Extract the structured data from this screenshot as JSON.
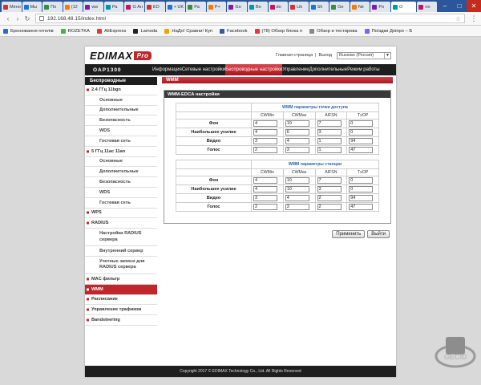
{
  "browser": {
    "tabs": [
      "Мено",
      "Мы",
      "По",
      "(12",
      "ww",
      "Ра",
      "G Ан",
      "ED",
      "+ UK",
      "Ра",
      "Р+",
      "Go",
      "Во",
      "do",
      "Lik",
      "Sh",
      "Ge",
      "Ne",
      "Po",
      "O",
      "no"
    ],
    "active_tab_index": 19,
    "url": "192.168.48.15/index.html",
    "bookmarks": [
      {
        "label": "Бронювання готелів",
        "color": "#2a6bd1"
      },
      {
        "label": "ROZETKA",
        "color": "#4caf50"
      },
      {
        "label": "AliExpress",
        "color": "#e53935"
      },
      {
        "label": "Lamoda",
        "color": "#222222"
      },
      {
        "label": "НаДо! Сравни! Куп",
        "color": "#f4a300"
      },
      {
        "label": "Facebook",
        "color": "#3b5998"
      },
      {
        "label": "(78) Обзор блока п",
        "color": "#e53935"
      },
      {
        "label": "Обзор и тестирова",
        "color": "#888888"
      },
      {
        "label": "Поїздки Дніпро – Б",
        "color": "#7b61ff"
      }
    ]
  },
  "router": {
    "brand": "EDIMAX",
    "brand_suffix": "Pro",
    "top_links": {
      "home": "Главная страница",
      "logout": "Выход"
    },
    "language": "Russian (Россия)",
    "model": "OAP1300",
    "nav": [
      "Информация",
      "Сетевые настройки",
      "Беспроводные настройки",
      "Управление",
      "Дополнительные",
      "Режим работы"
    ],
    "nav_active_index": 2,
    "sidebar_title": "Беспроводные",
    "sidebar": [
      {
        "label": "2.4 ГГц 11bgn",
        "kind": "group"
      },
      {
        "label": "Основные",
        "kind": "sub"
      },
      {
        "label": "Дополнительные",
        "kind": "sub"
      },
      {
        "label": "Безопасность",
        "kind": "sub"
      },
      {
        "label": "WDS",
        "kind": "sub"
      },
      {
        "label": "Гостевая сеть",
        "kind": "sub"
      },
      {
        "label": "5 ГГц 11ac 11an",
        "kind": "group"
      },
      {
        "label": "Основные",
        "kind": "sub"
      },
      {
        "label": "Дополнительные",
        "kind": "sub"
      },
      {
        "label": "Безопасность",
        "kind": "sub"
      },
      {
        "label": "WDS",
        "kind": "sub"
      },
      {
        "label": "Гостевая сеть",
        "kind": "sub"
      },
      {
        "label": "WPS",
        "kind": "group"
      },
      {
        "label": "RADIUS",
        "kind": "group"
      },
      {
        "label": "Настройки RADIUS сервера",
        "kind": "sub2"
      },
      {
        "label": "Внутренний сервер",
        "kind": "sub"
      },
      {
        "label": "Учетные записи для RADIUS сервера",
        "kind": "sub2"
      },
      {
        "label": "MAC фильтр",
        "kind": "group"
      },
      {
        "label": "WMM",
        "kind": "group",
        "selected": true
      },
      {
        "label": "Расписание",
        "kind": "group"
      },
      {
        "label": "Управление трафиком",
        "kind": "group"
      },
      {
        "label": "Bandsteering",
        "kind": "group"
      }
    ],
    "main_title": "WMM",
    "box_title": "WMM-EDCA настройки",
    "ap_table": {
      "caption": "WMM параметры точки доступа",
      "headers": [
        "CWMin",
        "CWMax",
        "AIFSN",
        "TxOP"
      ],
      "rows": [
        {
          "label": "Фон",
          "values": [
            "4",
            "10",
            "7",
            "0"
          ]
        },
        {
          "label": "Наибольшее усилие",
          "values": [
            "4",
            "6",
            "3",
            "0"
          ]
        },
        {
          "label": "Видео",
          "values": [
            "3",
            "4",
            "1",
            "94"
          ]
        },
        {
          "label": "Голос",
          "values": [
            "2",
            "3",
            "1",
            "47"
          ]
        }
      ]
    },
    "sta_table": {
      "caption": "WMM параметры станции",
      "headers": [
        "CWMin",
        "CWMax",
        "AIFSN",
        "TxOP"
      ],
      "rows": [
        {
          "label": "Фон",
          "values": [
            "4",
            "10",
            "7",
            "0"
          ]
        },
        {
          "label": "Наибольшее усилие",
          "values": [
            "4",
            "10",
            "3",
            "0"
          ]
        },
        {
          "label": "Видео",
          "values": [
            "3",
            "4",
            "2",
            "94"
          ]
        },
        {
          "label": "Голос",
          "values": [
            "2",
            "3",
            "2",
            "47"
          ]
        }
      ]
    },
    "apply_label": "Применить",
    "exit_label": "Выйти",
    "footer": "Copyright 2017 © EDIMAX Technology Co., Ltd. All Rights Reserved"
  },
  "colors": {
    "accent": "#c0272d",
    "nav_bg": "#1e1e1e",
    "browser_tabbar": "#2b579a"
  }
}
